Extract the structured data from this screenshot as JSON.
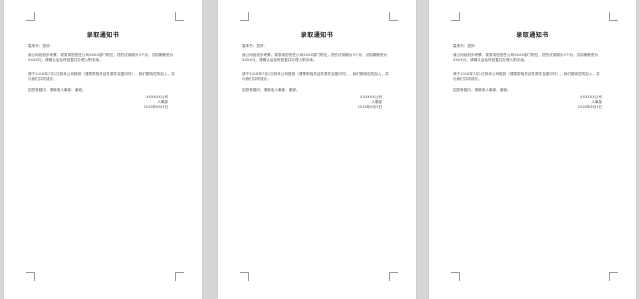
{
  "pages": [
    {
      "title": "录取通知书",
      "salutation": "嘉禾书：您好:",
      "paragraph1": "我公司经初步考察，现录用您担任公司XXXX部门职位，您的试用期为3个月，试用期薪资为XXXX元，请确认后及时回复并办理入职手续。",
      "paragraph2": "请于2018年7月1日到本公司报到（请携带相关证件原件及复印件），我们期待您的加入，并与我们共同成长。",
      "paragraph3": "如您有疑问，请致电人事部，谢谢。",
      "sign_company": "XXXXXX公司",
      "sign_dept": "人事部",
      "sign_date": "2018年6月3日"
    },
    {
      "title": "录取通知书",
      "salutation": "嘉禾书：您好:",
      "paragraph1": "我公司经初步考察，现录用您担任公司XXXX部门职位，您的试用期为3个月，试用期薪资为XXXX元，请确认后及时回复并办理入职手续。",
      "paragraph2": "请于2018年7月1日到本公司报到（请携带相关证件原件及复印件），我们期待您的加入，并与我们共同成长。",
      "paragraph3": "如您有疑问，请致电人事部，谢谢。",
      "sign_company": "XXXXXX公司",
      "sign_dept": "人事部",
      "sign_date": "2018年6月3日"
    },
    {
      "title": "录取通知书",
      "salutation": "嘉禾书：您好:",
      "paragraph1": "我公司经初步考察，现录用您担任公司XXXX部门职位，您的试用期为3个月，试用期薪资为XXXX元，请确认后及时回复并办理入职手续。",
      "paragraph2": "请于2018年7月1日到本公司报到（请携带相关证件原件及复印件），我们期待您的加入，并与我们共同成长。",
      "paragraph3": "如您有疑问，请致电人事部，谢谢。",
      "sign_company": "XXXXXX公司",
      "sign_dept": "人事部",
      "sign_date": "2018年6月3日"
    }
  ]
}
